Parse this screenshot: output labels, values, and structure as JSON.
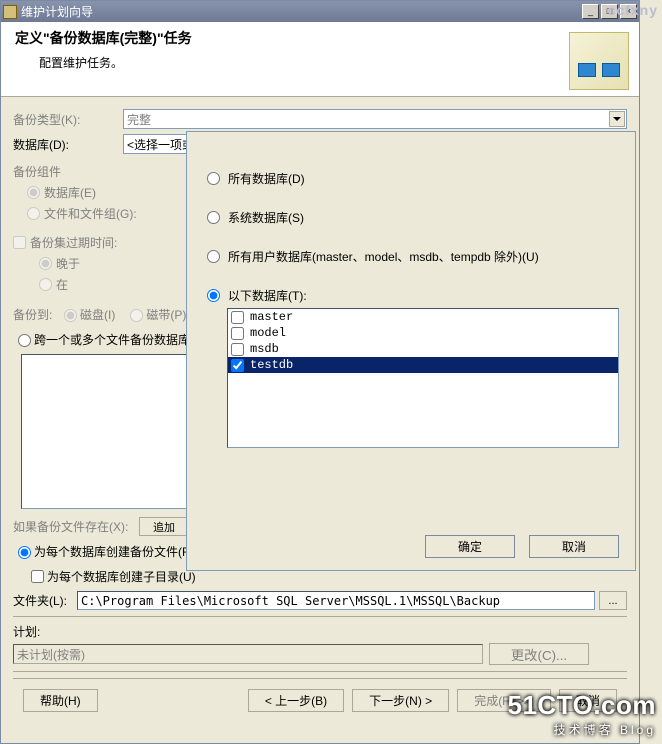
{
  "watermark": {
    "top": "ccfxny",
    "brand": "51CTO.com",
    "brand_sub": "技术博客 Blog"
  },
  "window": {
    "title": "维护计划向导",
    "min": "_",
    "max": "□",
    "close": "×"
  },
  "header": {
    "title": "定义\"备份数据库(完整)\"任务",
    "subtitle": "配置维护任务。"
  },
  "form": {
    "backup_type_label": "备份类型(K):",
    "backup_type_value": "完整",
    "database_label": "数据库(D):",
    "database_value": "<选择一项或多项>",
    "component_label": "备份组件",
    "radio_db": "数据库(E)",
    "radio_files": "文件和文件组(G):",
    "expire_cb": "备份集过期时间:",
    "after": "晚于",
    "at": "在",
    "backup_to": "备份到:",
    "disk": "磁盘(I)",
    "tape": "磁带(P)",
    "across": "跨一个或多个文件备份数据库(S):",
    "if_exist": "如果备份文件存在(X):",
    "append": "追加",
    "per_db": "为每个数据库创建备份文件(R)",
    "sub_per_db": "为每个数据库创建子目录(U)",
    "folder_label": "文件夹(L):",
    "folder_value": "C:\\Program Files\\Microsoft SQL Server\\MSSQL.1\\MSSQL\\Backup",
    "browse": "...",
    "schedule_label": "计划:",
    "schedule_value": "未计划(按需)",
    "change": "更改(C)...",
    "help": "帮助(H)",
    "back": "< 上一步(B)",
    "next": "下一步(N) >",
    "finish": "完成(F) >>|",
    "cancel_wiz": "取消"
  },
  "popup": {
    "opt_all": "所有数据库(D)",
    "opt_sys": "系统数据库(S)",
    "opt_user": "所有用户数据库(master、model、msdb、tempdb 除外)(U)",
    "opt_these": "以下数据库(T):",
    "dbs": [
      {
        "name": "master",
        "checked": false,
        "selected": false
      },
      {
        "name": "model",
        "checked": false,
        "selected": false
      },
      {
        "name": "msdb",
        "checked": false,
        "selected": false
      },
      {
        "name": "testdb",
        "checked": true,
        "selected": true
      }
    ],
    "ok": "确定",
    "cancel": "取消"
  }
}
